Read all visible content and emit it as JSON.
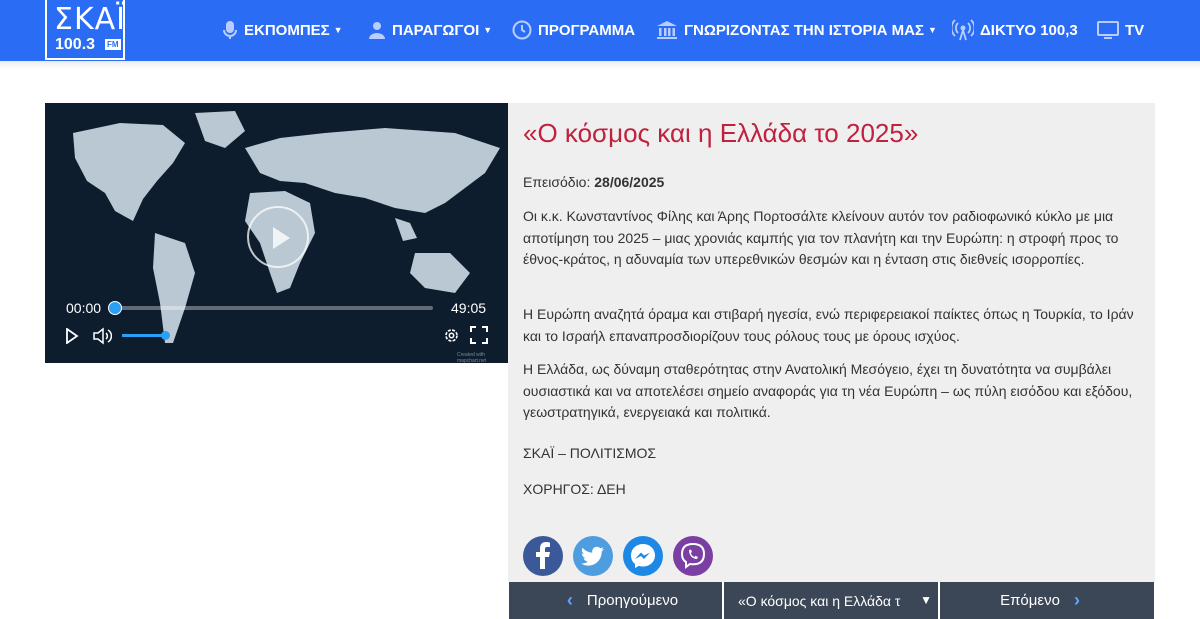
{
  "header": {
    "logo_text": "ΣΚΑΪ",
    "logo_freq": "100.3",
    "logo_fm": "FM",
    "nav": [
      {
        "label": "ΕΚΠΟΜΠΕΣ",
        "icon": "microphone-icon"
      },
      {
        "label": "ΠΑΡΑΓΩΓΟΙ",
        "icon": "user-icon"
      },
      {
        "label": "ΠΡΟΓΡΑΜΜΑ",
        "icon": "clock-icon"
      },
      {
        "label": "ΓΝΩΡΙΖΟΝΤΑΣ ΤΗΝ ΙΣΤΟΡΙΑ ΜΑΣ",
        "icon": "museum-icon"
      },
      {
        "label": "ΔΙΚΤΥΟ 100,3",
        "icon": "broadcast-icon"
      },
      {
        "label": "TV",
        "icon": "tv-icon"
      }
    ]
  },
  "player": {
    "current_time": "00:00",
    "duration": "49:05",
    "progress": 0,
    "volume": 1.0,
    "watermark": "Created with mapchart.net"
  },
  "article": {
    "title": "«Ο κόσμος και η Ελλάδα το 2025»",
    "episode_label": "Επεισόδιο:",
    "episode_date": "28/06/2025",
    "paragraphs": [
      "Οι κ.κ. Κωνσταντίνος Φίλης και Άρης Πορτοσάλτε κλείνουν αυτόν τον ραδιοφωνικό κύκλο με μια αποτίμηση του 2025 – μιας χρονιάς καμπής για τον πλανήτη και την Ευρώπη: η στροφή προς το έθνος-κράτος, η αδυναμία των υπερεθνικών θεσμών και η ένταση στις διεθνείς ισορροπίες.",
      "Η Ευρώπη αναζητά όραμα και στιβαρή ηγεσία, ενώ περιφερειακοί παίκτες όπως η Τουρκία, το Ιράν και το Ισραήλ επαναπροσδιορίζουν τους ρόλους τους με όρους ισχύος.",
      "Η Ελλάδα, ως δύναμη σταθερότητας στην Ανατολική Μεσόγειο, έχει τη δυνατότητα να συμβάλει ουσιαστικά και να αποτελέσει σημείο αναφοράς για τη νέα Ευρώπη – ως πύλη εισόδου και εξόδου, γεωστρατηγικά, ενεργειακά και πολιτικά.",
      "ΣΚΑΪ – ΠΟΛΙΤΙΣΜΟΣ",
      "ΧΟΡΗΓΟΣ: ΔΕΗ"
    ]
  },
  "share": [
    {
      "name": "facebook",
      "color": "#3b5998",
      "glyph": "f"
    },
    {
      "name": "twitter",
      "color": "#4d9de0",
      "glyph": "t"
    },
    {
      "name": "messenger",
      "color": "#1e88e5",
      "glyph": "m"
    },
    {
      "name": "viber",
      "color": "#7b3fa3",
      "glyph": "v"
    }
  ],
  "pager": {
    "prev_label": "Προηγούμενο",
    "select_value": "«Ο κόσμος και η Ελλάδα τ",
    "next_label": "Επόμενο"
  },
  "colors": {
    "brand_blue": "#2a6df4",
    "title_red": "#c0213e",
    "pager_bg": "#3b4656"
  }
}
